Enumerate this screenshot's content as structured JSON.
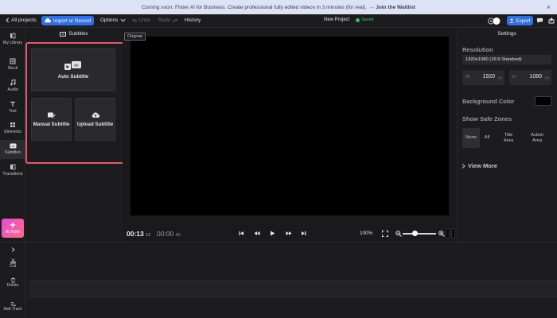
{
  "banner": {
    "text": "Coming soon: Flixier AI for Business. Create professional fully edited videos in 3 minutes (for real).",
    "link": "→ Join the Waitlist",
    "close": "×"
  },
  "topbar": {
    "all_projects": "All projects",
    "import": "Import or Record",
    "options": "Options",
    "undo": "Undo",
    "redo": "Redo",
    "history": "History",
    "project_name": "New Project",
    "saved": "Saved",
    "export": "Export"
  },
  "leftnav": {
    "items": [
      {
        "label": "My Library",
        "icon": "library-icon"
      },
      {
        "label": "Stock",
        "icon": "stock-icon"
      },
      {
        "label": "Audio",
        "icon": "music-icon"
      },
      {
        "label": "Text",
        "icon": "text-icon"
      },
      {
        "label": "Elements",
        "icon": "elements-icon"
      },
      {
        "label": "Subtitles",
        "icon": "subtitles-icon",
        "active": true
      },
      {
        "label": "Transitions",
        "icon": "transitions-icon"
      }
    ],
    "ai_tools": "AI Tools"
  },
  "panel": {
    "title": "Subtitles",
    "cc": "cc",
    "auto": "Auto Subtitle",
    "manual": "Manual Subtitle",
    "upload": "Upload Subtitle"
  },
  "preview": {
    "original": "Original",
    "current_time": "00:13",
    "current_frames": "12",
    "total_time": "00:00",
    "total_frames": "00",
    "zoom": "100%",
    "zoom_level": 0.35
  },
  "settings": {
    "title": "Settings",
    "resolution_label": "Resolution",
    "resolution_value": "1920x1080 (16:9 Standard)",
    "width_label": "W",
    "width": "1920",
    "height_label": "H",
    "height": "1080",
    "unit": "px",
    "bg_label": "Background Color",
    "bg_color": "#000000",
    "safe_label": "Show Safe Zones",
    "zones": [
      "None",
      "All",
      "Title Area",
      "Action Area"
    ],
    "view_more": "View More"
  },
  "timeline": {
    "cut": "Cut",
    "delete": "Delete",
    "add_track": "Add Track"
  },
  "colors": {
    "accent": "#2f6fe8",
    "highlight": "#e8566b",
    "saved": "#38c172"
  }
}
